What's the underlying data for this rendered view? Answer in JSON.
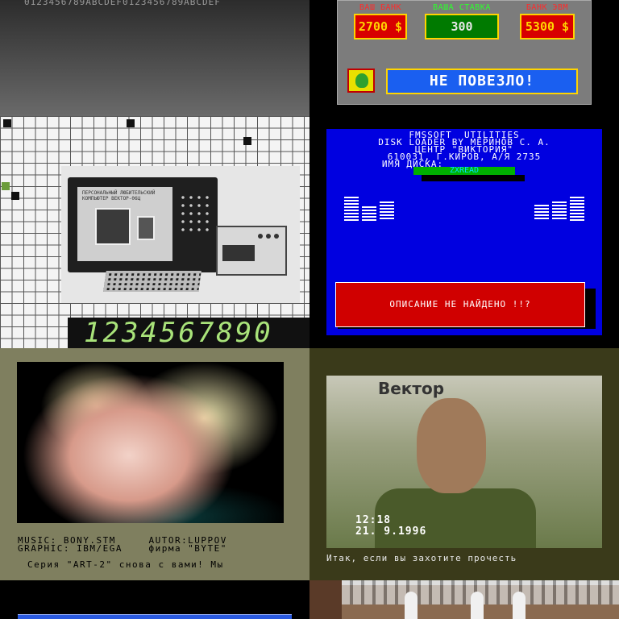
{
  "hex_strip": "0123456789ABCDEF0123456789ABCDEF",
  "casino": {
    "bank_label": "ВАШ БАНК",
    "bank_value": "2700 $",
    "bet_label": "ВАША СТАВКА",
    "bet_value": "300",
    "pc_bank_label": "БАНК ЭВМ",
    "pc_bank_value": "5300 $",
    "message": "НЕ ПОВЕЗЛО!"
  },
  "computer_ad": {
    "screen_caption": "ПЕРСОНАЛЬНЫЙ ЛЮБИТЕЛЬСКИЙ КОМПЬЮТЕР ВЕКТОР-06Ц",
    "digits": "1234567890"
  },
  "loader": {
    "line1": "FMSSOFT  UTILITIES",
    "line2": "DISK LOADER BY МЕРИНОВ С. А.",
    "line3": "ЦЕНТР \"ВИКТОРИЯ\"",
    "line4": "610031, Г.КИРОВ, А/Я 2735",
    "line5": "ИМЯ ДИСКА:",
    "disk_name": "ZXREAD",
    "error": "ОПИСАНИЕ НЕ НАЙДЕНО !!?"
  },
  "art_demo": {
    "credits_line1": "MUSIC: BONY.STM     AUTOR:LUPPOV",
    "credits_line2": "GRAPHIC: IBM/EGA    фирма \"BYTE\"",
    "scroller": "Серия \"ART-2\" снова с вами! Мы"
  },
  "video": {
    "sign": "Вектор",
    "time": "12:18",
    "date": "21. 9.1996",
    "caption": "Итак, если вы захотите прочесть"
  }
}
